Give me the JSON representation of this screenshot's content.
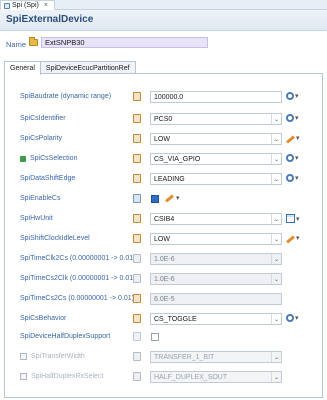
{
  "window_tab": {
    "label": "Spi (Spi)",
    "close": "×"
  },
  "header": {
    "title": "SpiExternalDevice"
  },
  "name": {
    "label": "Name",
    "value": "ExtSNPB30"
  },
  "tabs": [
    {
      "label": "General",
      "active": true
    },
    {
      "label": "SpiDeviceEcucPartitionRef",
      "active": false
    }
  ],
  "rows": [
    {
      "label": "SpiBaudrate (dynamic range)",
      "value": "100000.0",
      "type": "textbox",
      "icon": "doc",
      "action": "gear"
    },
    {
      "label": "SpiCsIdentifier",
      "value": "PCS0",
      "type": "combo",
      "icon": "doc",
      "action": "gear"
    },
    {
      "label": "SpiCsPolarity",
      "value": "LOW",
      "type": "combo",
      "icon": "doc",
      "action": "pencil"
    },
    {
      "label": "SpiCsSelection",
      "value": "CS_VIA_GPIO",
      "type": "combo",
      "icon": "doc",
      "action": "gear",
      "prefix_icon": "green"
    },
    {
      "label": "SpiDataShiftEdge",
      "value": "LEADING",
      "type": "combo",
      "icon": "doc",
      "action": "gear"
    },
    {
      "label": "SpiEnableCs",
      "value": "",
      "type": "checkbox-blue",
      "icon": "flag",
      "action": "inline"
    },
    {
      "label": "SpiHwUnit",
      "value": "CSIB4",
      "type": "combo",
      "icon": "doc",
      "action": "table"
    },
    {
      "label": "SpiShiftClockIdleLevel",
      "value": "LOW",
      "type": "combo",
      "icon": "doc",
      "action": "pencil"
    },
    {
      "label": "SpiTimeClk2Cs (0.00000001 -> 0.01)",
      "value": "1.0E-6",
      "type": "readonly-combo",
      "icon": "doc-grey",
      "action": ""
    },
    {
      "label": "SpiTimeCs2Clk (0.00000001 -> 0.01)",
      "value": "1.0E-6",
      "type": "readonly-combo",
      "icon": "doc-grey",
      "action": ""
    },
    {
      "label": "SpiTimeCs2Cs (0.00000001 -> 0.01)",
      "value": "6.0E-5",
      "type": "readonly",
      "icon": "doc",
      "action": ""
    },
    {
      "label": "SpiCsBehavior",
      "value": "CS_TOGGLE",
      "type": "combo",
      "icon": "doc",
      "action": "gear"
    },
    {
      "label": "SpiDeviceHalfDuplexSupport",
      "value": "",
      "type": "checkbox",
      "icon": "flag-grey",
      "action": ""
    },
    {
      "label": "SpiTransferWidth",
      "value": "TRANSFER_1_BIT",
      "type": "disabled-combo",
      "icon": "doc-grey",
      "action": "",
      "disabled": true
    },
    {
      "label": "SpiHalfDuplexRxSelect",
      "value": "HALF_DUPLEX_SOUT",
      "type": "disabled-combo",
      "icon": "doc-grey",
      "action": "",
      "disabled": true
    }
  ]
}
